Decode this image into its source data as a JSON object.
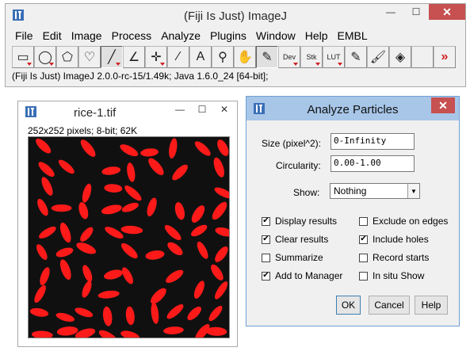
{
  "main_window": {
    "title": "(Fiji Is Just) ImageJ",
    "minimize": "—",
    "maximize": "☐",
    "close": "✕",
    "menu": [
      "File",
      "Edit",
      "Image",
      "Process",
      "Analyze",
      "Plugins",
      "Window",
      "Help",
      "EMBL"
    ],
    "tools": [
      {
        "name": "rectangle-tool",
        "glyph": "▭",
        "has_menu": true
      },
      {
        "name": "oval-tool",
        "glyph": "◯",
        "has_menu": true
      },
      {
        "name": "polygon-tool",
        "glyph": "⬠",
        "has_menu": false
      },
      {
        "name": "freehand-tool",
        "glyph": "♡",
        "has_menu": false
      },
      {
        "name": "line-tool",
        "glyph": "╱",
        "has_menu": true,
        "selected": true
      },
      {
        "name": "angle-tool",
        "glyph": "∠",
        "has_menu": false
      },
      {
        "name": "point-tool",
        "glyph": "✛",
        "has_menu": true
      },
      {
        "name": "wand-tool",
        "glyph": "⁄",
        "has_menu": false
      },
      {
        "name": "text-tool",
        "glyph": "A",
        "has_menu": false
      },
      {
        "name": "magnifier-tool",
        "glyph": "⚲",
        "has_menu": false
      },
      {
        "name": "scroll-tool",
        "glyph": "✋",
        "has_menu": false
      },
      {
        "name": "color-picker-tool",
        "glyph": "✎",
        "has_menu": false,
        "selected": true
      },
      {
        "name": "dev-menu-tool",
        "label": "Dev",
        "has_menu": true
      },
      {
        "name": "stk-menu-tool",
        "label": "Stk",
        "has_menu": true
      },
      {
        "name": "lut-menu-tool",
        "label": "LUT",
        "has_menu": true
      },
      {
        "name": "pencil-tool",
        "glyph": "✎",
        "has_menu": false
      },
      {
        "name": "brush-tool",
        "glyph": "🖌",
        "has_menu": false
      },
      {
        "name": "flood-fill-tool",
        "glyph": "◈",
        "has_menu": false
      },
      {
        "name": "empty-tool",
        "glyph": "",
        "has_menu": false
      },
      {
        "name": "more-tools-button",
        "glyph": "»",
        "has_menu": false
      }
    ],
    "status": "(Fiji Is Just) ImageJ 2.0.0-rc-15/1.49k; Java 1.6.0_24 [64-bit];"
  },
  "image_window": {
    "title": "rice-1.tif",
    "minimize": "—",
    "maximize": "☐",
    "close": "✕",
    "info": "252x252 pixels; 8-bit; 62K",
    "object_color": "#ff1a1a"
  },
  "dialog": {
    "title": "Analyze Particles",
    "close": "✕",
    "size_label": "Size (pixel^2):",
    "size_value": "0-Infinity",
    "circularity_label": "Circularity:",
    "circularity_value": "0.00-1.00",
    "show_label": "Show:",
    "show_value": "Nothing",
    "options": {
      "display_results": {
        "label": "Display results",
        "checked": true
      },
      "exclude_on_edges": {
        "label": "Exclude on edges",
        "checked": false
      },
      "clear_results": {
        "label": "Clear results",
        "checked": true
      },
      "include_holes": {
        "label": "Include holes",
        "checked": true
      },
      "summarize": {
        "label": "Summarize",
        "checked": false
      },
      "record_starts": {
        "label": "Record starts",
        "checked": false
      },
      "add_to_manager": {
        "label": "Add to Manager",
        "checked": true
      },
      "in_situ_show": {
        "label": "In situ Show",
        "checked": false
      }
    },
    "ok_label": "OK",
    "cancel_label": "Cancel",
    "help_label": "Help"
  }
}
